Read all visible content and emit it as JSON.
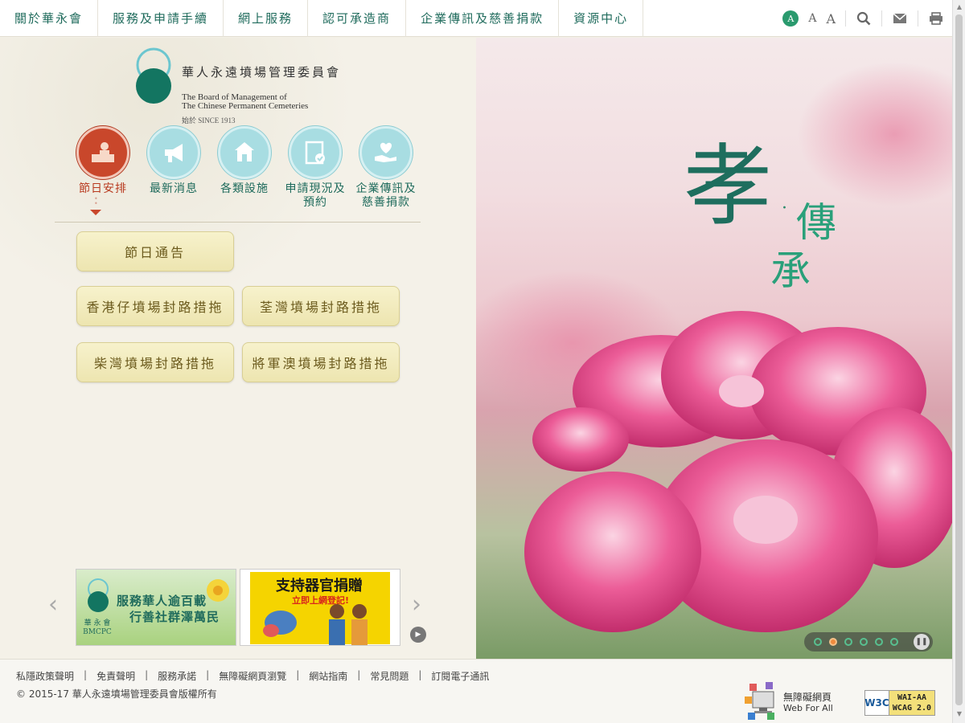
{
  "nav": {
    "items": [
      "關於華永會",
      "服務及申請手續",
      "網上服務",
      "認可承造商",
      "企業傳訊及慈善捐款",
      "資源中心"
    ],
    "font_sizes": [
      "A",
      "A",
      "A"
    ]
  },
  "logo": {
    "zh": "華人永遠墳場管理委員會",
    "en1": "The Board of Management of",
    "en2": "The Chinese Permanent Cemeteries",
    "since": "始於 SINCE 1913"
  },
  "quick_nav": [
    {
      "label": "節日安排",
      "icon": "festival-icon",
      "active": true
    },
    {
      "label": "最新消息",
      "icon": "megaphone-icon",
      "active": false
    },
    {
      "label": "各類設施",
      "icon": "building-icon",
      "active": false
    },
    {
      "label": "申請現況及預約",
      "icon": "checklist-icon",
      "active": false
    },
    {
      "label": "企業傳訊及慈善捐款",
      "icon": "heart-hand-icon",
      "active": false
    }
  ],
  "festival_buttons": [
    "節日通告",
    "香港仔墳場封路措拖",
    "荃灣墳場封路措拖",
    "柴灣墳場封路措拖",
    "將軍澳墳場封路措拖"
  ],
  "banners": {
    "b1": {
      "line1": "服務華人逾百載",
      "line2": "行善社群澤萬民",
      "logo_text": "華 永 會",
      "logo_sub": "BMCPC"
    },
    "b2": {
      "headline": "支持器官捐贈",
      "sub": "立即上網登記!"
    }
  },
  "hero": {
    "slogan_main": "孝",
    "slogan_dot": "·",
    "slogan_2": "傳",
    "slogan_3": "承",
    "slides": 6,
    "active_slide": 2
  },
  "footer": {
    "links": [
      "私隱政策聲明",
      "免責聲明",
      "服務承諾",
      "無障礙網頁瀏覽",
      "網站指南",
      "常見問題",
      "訂閱電子通訊"
    ],
    "copyright": "© 2015-17 華人永遠墳場管理委員會版權所有",
    "webforall_1": "無障礙網頁",
    "webforall_2": "Web For All",
    "w3c_logo": "W3C",
    "w3c_1": "WAI-AA",
    "w3c_2": "WCAG 2.0"
  },
  "colors": {
    "brand_green": "#1f6b5c",
    "active_red": "#c9472b",
    "pill_gold": "#ede5b0"
  }
}
